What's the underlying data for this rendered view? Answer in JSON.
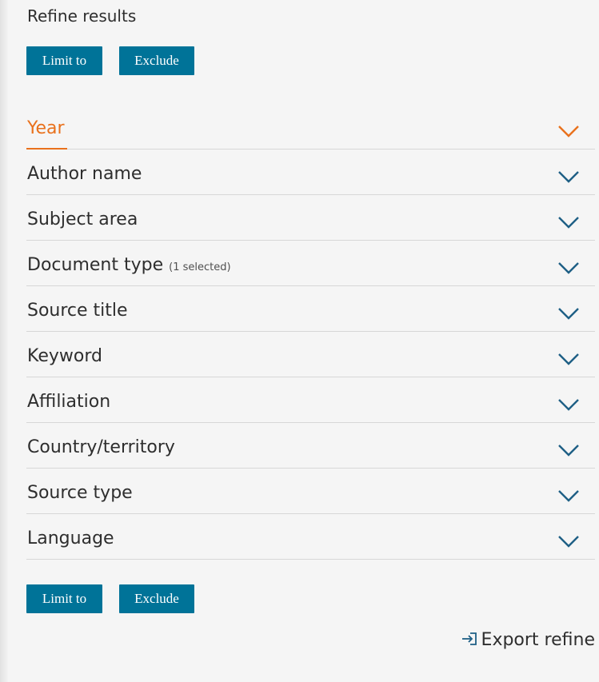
{
  "panel": {
    "title": "Refine results",
    "buttons": {
      "limit_to": "Limit to",
      "exclude": "Exclude"
    },
    "facets": [
      {
        "label": "Year",
        "note": "",
        "expanded": true
      },
      {
        "label": "Author name",
        "note": ""
      },
      {
        "label": "Subject area",
        "note": ""
      },
      {
        "label": "Document type",
        "note": "(1 selected)"
      },
      {
        "label": "Source title",
        "note": ""
      },
      {
        "label": "Keyword",
        "note": ""
      },
      {
        "label": "Affiliation",
        "note": ""
      },
      {
        "label": "Country/territory",
        "note": ""
      },
      {
        "label": "Source type",
        "note": ""
      },
      {
        "label": "Language",
        "note": ""
      }
    ],
    "export_label": "Export refine"
  },
  "colors": {
    "button_bg": "#007398",
    "active": "#e9711c",
    "chevron": "#1e5f85",
    "background": "#f5f5f5"
  },
  "icons": {
    "chevron": "chevron-down-icon",
    "export": "export-icon"
  }
}
